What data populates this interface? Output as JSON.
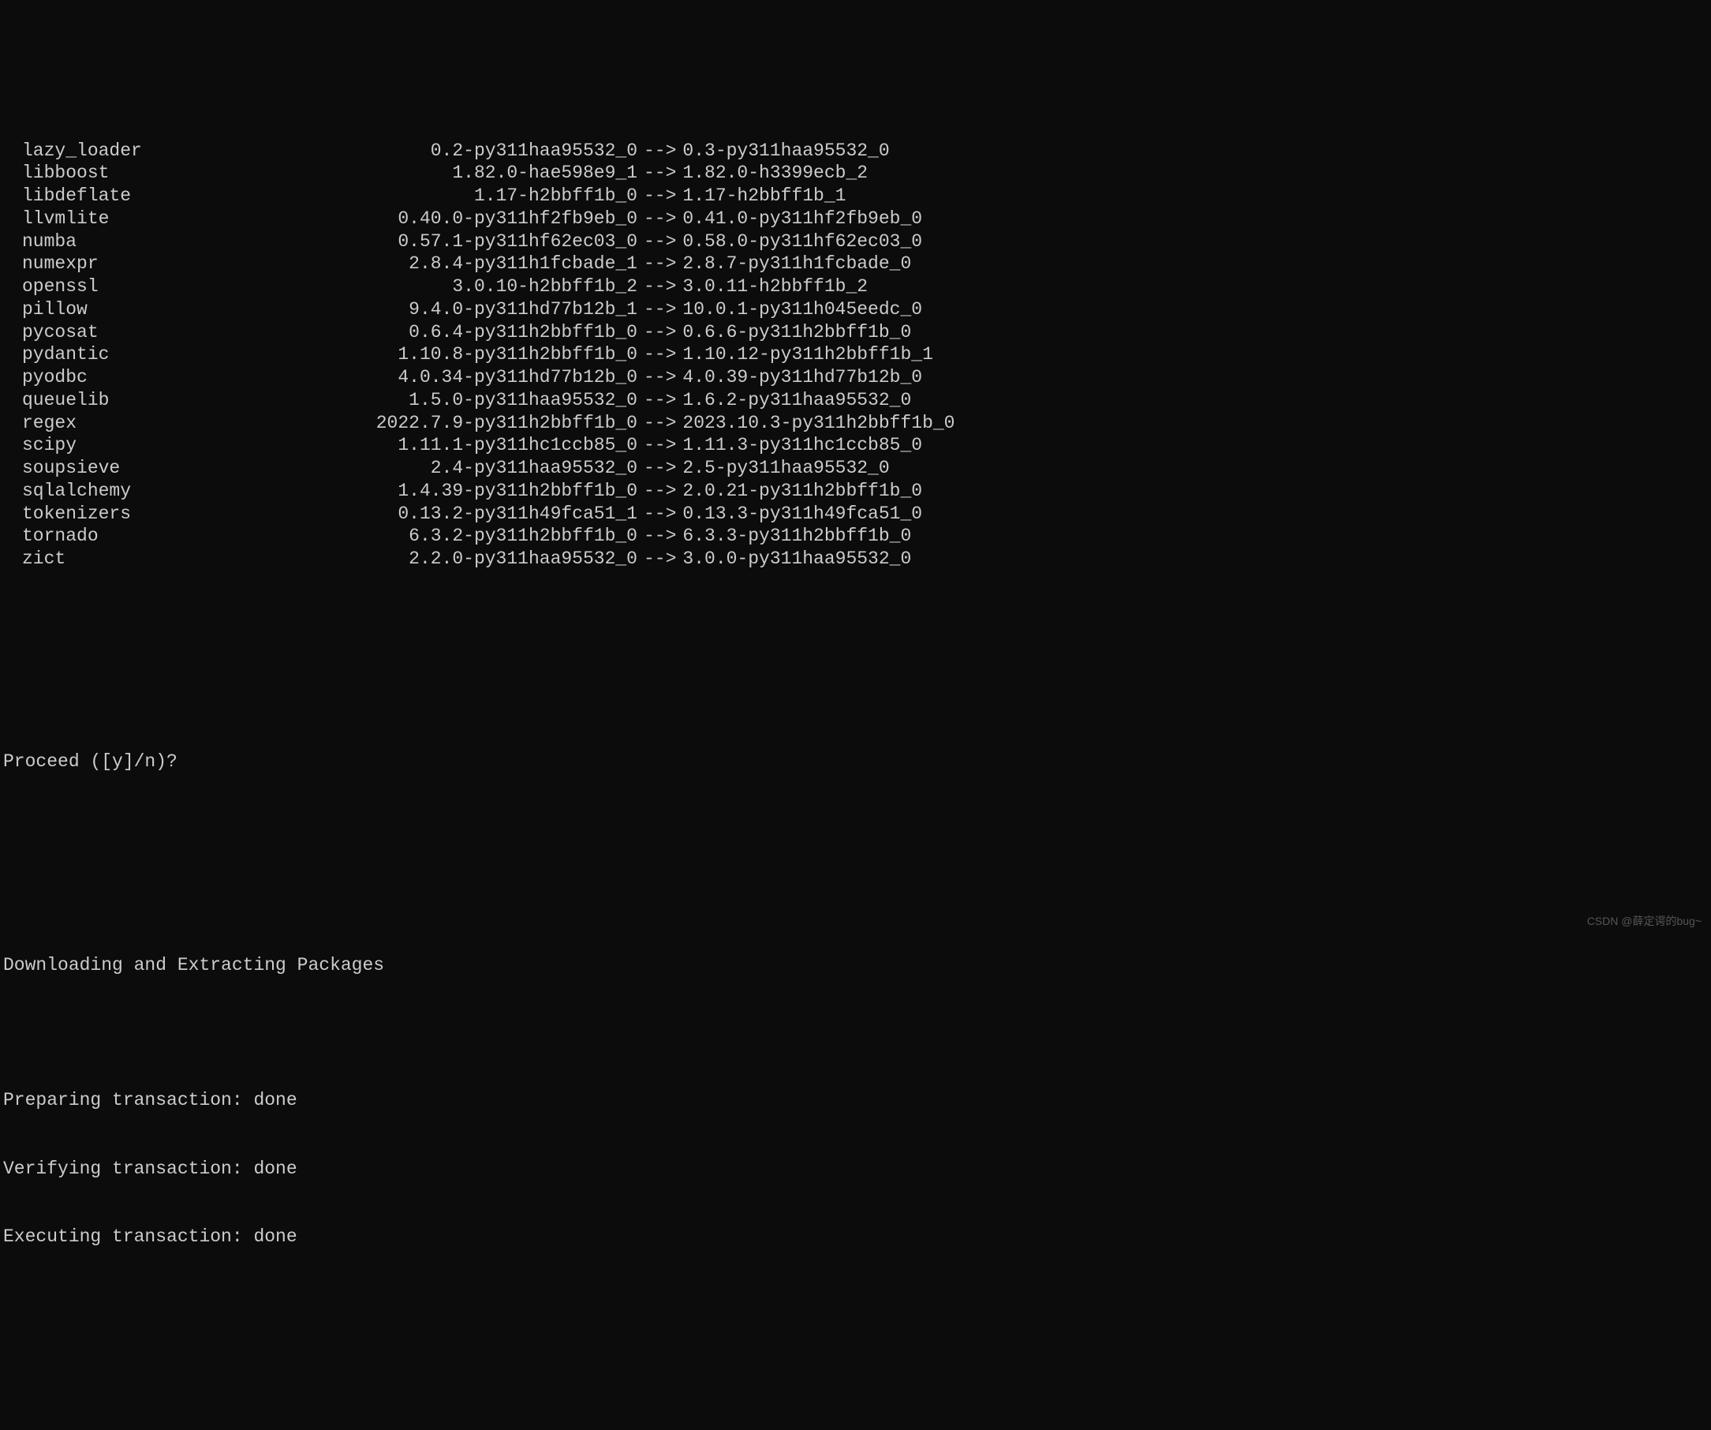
{
  "packages": [
    {
      "name": "lazy_loader",
      "from": "0.2-py311haa95532_0",
      "to": "0.3-py311haa95532_0"
    },
    {
      "name": "libboost",
      "from": "1.82.0-hae598e9_1",
      "to": "1.82.0-h3399ecb_2"
    },
    {
      "name": "libdeflate",
      "from": "1.17-h2bbff1b_0",
      "to": "1.17-h2bbff1b_1"
    },
    {
      "name": "llvmlite",
      "from": "0.40.0-py311hf2fb9eb_0",
      "to": "0.41.0-py311hf2fb9eb_0"
    },
    {
      "name": "numba",
      "from": "0.57.1-py311hf62ec03_0",
      "to": "0.58.0-py311hf62ec03_0"
    },
    {
      "name": "numexpr",
      "from": "2.8.4-py311h1fcbade_1",
      "to": "2.8.7-py311h1fcbade_0"
    },
    {
      "name": "openssl",
      "from": "3.0.10-h2bbff1b_2",
      "to": "3.0.11-h2bbff1b_2"
    },
    {
      "name": "pillow",
      "from": "9.4.0-py311hd77b12b_1",
      "to": "10.0.1-py311h045eedc_0"
    },
    {
      "name": "pycosat",
      "from": "0.6.4-py311h2bbff1b_0",
      "to": "0.6.6-py311h2bbff1b_0"
    },
    {
      "name": "pydantic",
      "from": "1.10.8-py311h2bbff1b_0",
      "to": "1.10.12-py311h2bbff1b_1"
    },
    {
      "name": "pyodbc",
      "from": "4.0.34-py311hd77b12b_0",
      "to": "4.0.39-py311hd77b12b_0"
    },
    {
      "name": "queuelib",
      "from": "1.5.0-py311haa95532_0",
      "to": "1.6.2-py311haa95532_0"
    },
    {
      "name": "regex",
      "from": "2022.7.9-py311h2bbff1b_0",
      "to": "2023.10.3-py311h2bbff1b_0"
    },
    {
      "name": "scipy",
      "from": "1.11.1-py311hc1ccb85_0",
      "to": "1.11.3-py311hc1ccb85_0"
    },
    {
      "name": "soupsieve",
      "from": "2.4-py311haa95532_0",
      "to": "2.5-py311haa95532_0"
    },
    {
      "name": "sqlalchemy",
      "from": "1.4.39-py311h2bbff1b_0",
      "to": "2.0.21-py311h2bbff1b_0"
    },
    {
      "name": "tokenizers",
      "from": "0.13.2-py311h49fca51_1",
      "to": "0.13.3-py311h49fca51_0"
    },
    {
      "name": "tornado",
      "from": "6.3.2-py311h2bbff1b_0",
      "to": "6.3.3-py311h2bbff1b_0"
    },
    {
      "name": "zict",
      "from": "2.2.0-py311haa95532_0",
      "to": "3.0.0-py311haa95532_0"
    }
  ],
  "arrow": "-->",
  "prompt": "Proceed ([y]/n)?",
  "download_header": "Downloading and Extracting Packages",
  "status": {
    "preparing_label": "Preparing transaction: ",
    "preparing_value": "done",
    "verifying_label": "Verifying transaction: ",
    "verifying_value": "done",
    "executing_label": "Executing transaction: ",
    "executing_value": "done"
  },
  "watermark": "CSDN @薛定谔的bug~"
}
